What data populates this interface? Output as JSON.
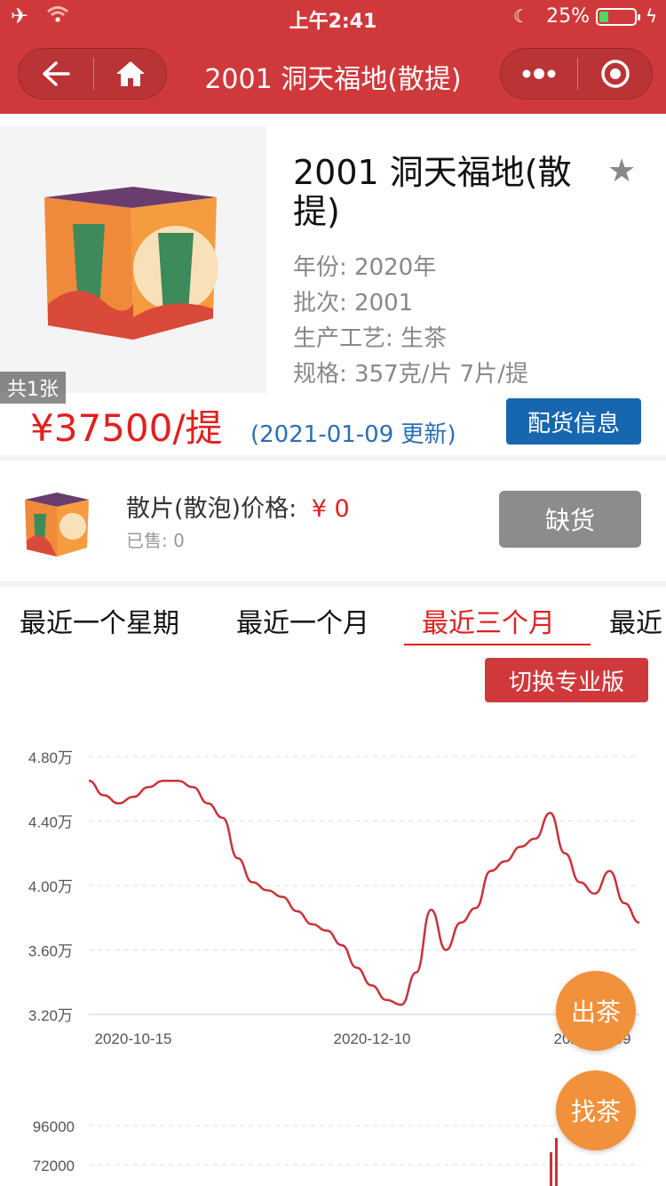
{
  "status_bar": {
    "time": "上午2:41",
    "battery": "25%"
  },
  "navbar": {
    "title": "2001 洞天福地(散提)"
  },
  "product": {
    "image_count": "共1张",
    "name": "2001 洞天福地(散提)",
    "year": "年份: 2020年",
    "batch": "批次: 2001",
    "process": "生产工艺: 生茶",
    "spec": "规格: 357克/片 7片/提",
    "price": "¥37500/提",
    "updated": "(2021-01-09 更新)",
    "shipping_button": "配货信息"
  },
  "loose": {
    "label": "散片(散泡)价格:",
    "price": "¥ 0",
    "sold": "已售: 0",
    "button": "缺货"
  },
  "tabs": [
    "最近一个星期",
    "最近一个月",
    "最近三个月",
    "最近"
  ],
  "active_tab": 2,
  "pro_button": "切换专业版",
  "fab": {
    "sell": "出茶",
    "find": "找茶"
  },
  "colors": {
    "brand_red": "#d0393b",
    "price_red": "#e02020",
    "blue": "#1766b0",
    "orange": "#f1913b"
  },
  "chart_data": {
    "type": "line",
    "x_ticks": [
      "2020-10-15",
      "2020-12-10",
      "2021-01-09"
    ],
    "y_ticks": [
      "4.80万",
      "4.40万",
      "4.00万",
      "3.60万",
      "3.20万"
    ],
    "ylim": [
      32000,
      48000
    ],
    "grid": true,
    "series": [
      {
        "values": [
          46500,
          45600,
          45100,
          45500,
          46100,
          46500,
          46500,
          46100,
          45100,
          44200,
          41700,
          40200,
          39700,
          39300,
          38400,
          37600,
          37200,
          36300,
          34900,
          33800,
          32900,
          32600,
          34600,
          38500,
          36000,
          37700,
          38600,
          40900,
          41500,
          42400,
          42900,
          44500,
          42000,
          40200,
          39500,
          40900,
          38900,
          37700
        ]
      }
    ]
  },
  "volume_chart": {
    "y_ticks": [
      "96000",
      "72000"
    ]
  }
}
